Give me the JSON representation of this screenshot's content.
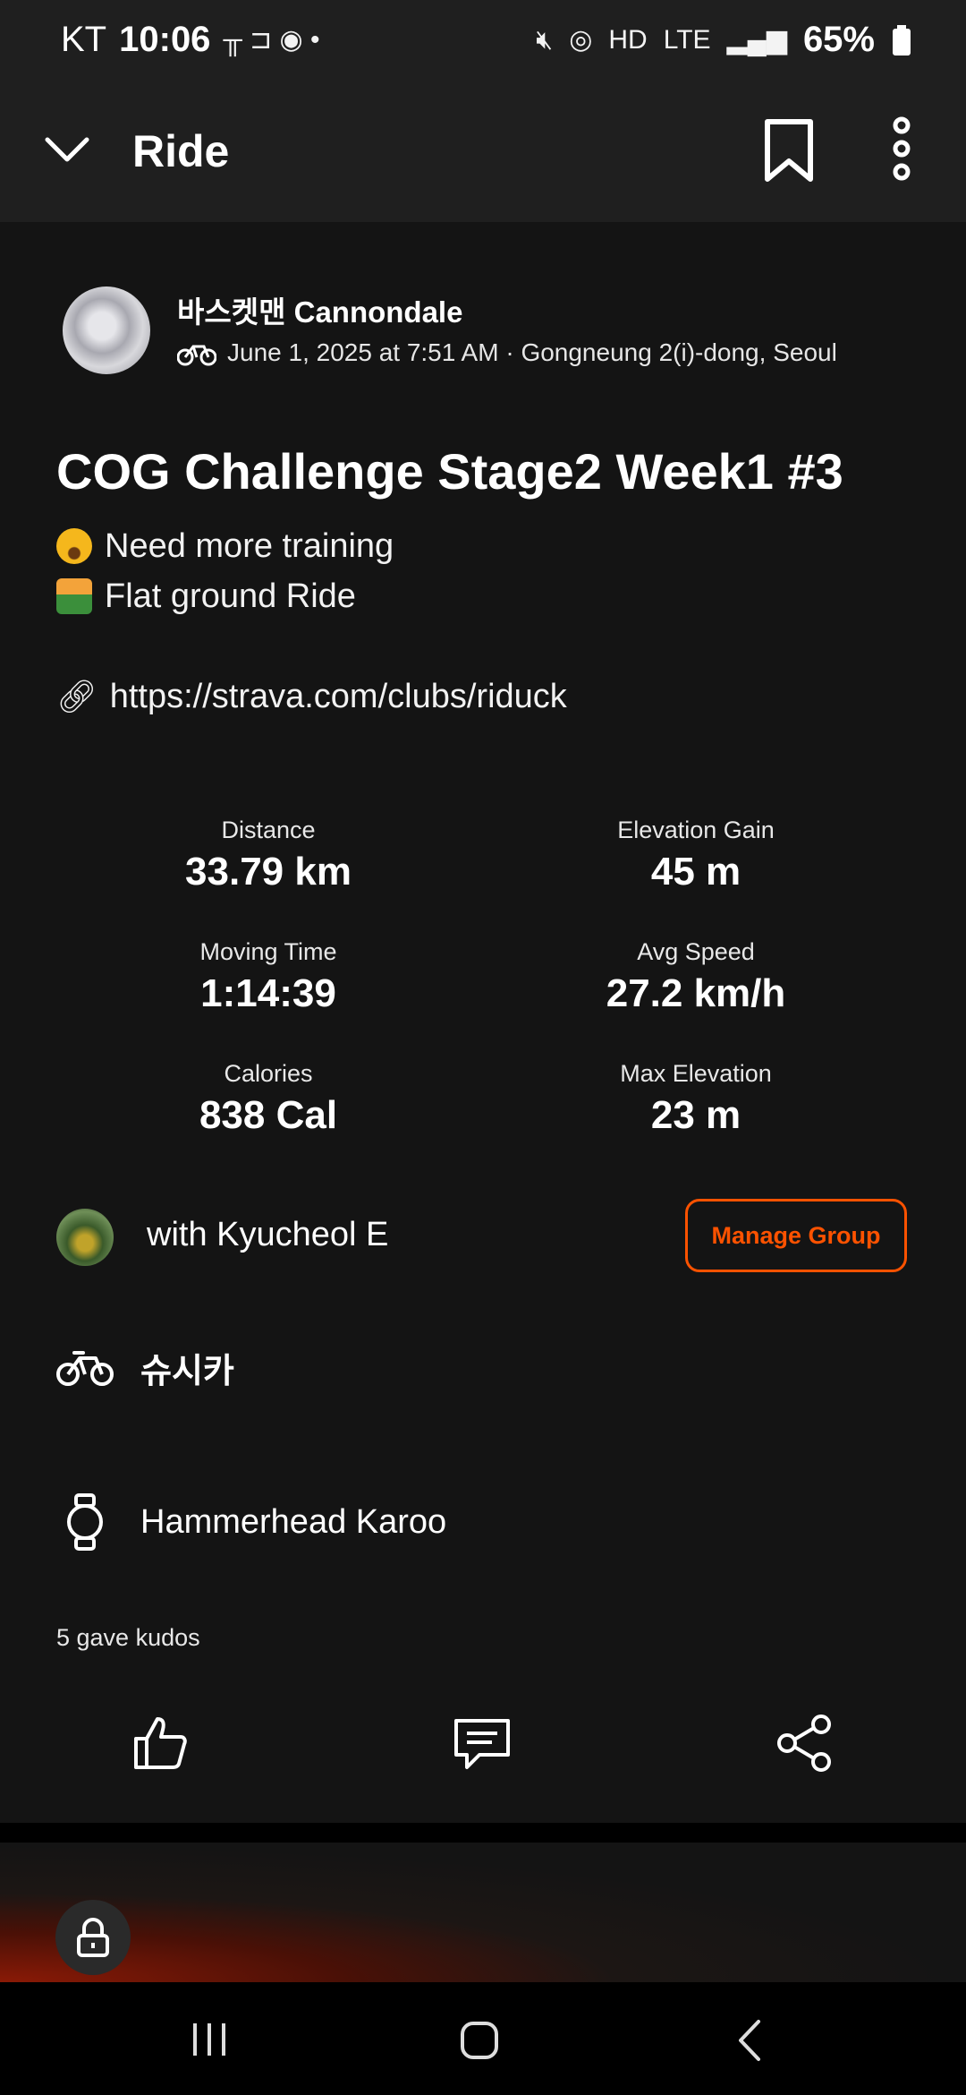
{
  "status_bar": {
    "carrier": "KT",
    "time": "10:06",
    "battery": "65%"
  },
  "header": {
    "title": "Ride"
  },
  "activity": {
    "author": "바스켓맨 Cannondale",
    "meta": "June 1, 2025 at 7:51 AM · Gongneung 2(i)-dong, Seoul",
    "title": "COG Challenge Stage2 Week1 #3",
    "description_line1": "Need more training",
    "description_line2": "Flat ground Ride",
    "link": "https://strava.com/clubs/riduck"
  },
  "stats": {
    "distance_label": "Distance",
    "distance_value": "33.79 km",
    "elevation_gain_label": "Elevation Gain",
    "elevation_gain_value": "45 m",
    "moving_time_label": "Moving Time",
    "moving_time_value": "1:14:39",
    "avg_speed_label": "Avg Speed",
    "avg_speed_value": "27.2 km/h",
    "calories_label": "Calories",
    "calories_value": "838 Cal",
    "max_elevation_label": "Max Elevation",
    "max_elevation_value": "23 m"
  },
  "group": {
    "with_text": "with Kyucheol E",
    "manage_label": "Manage Group"
  },
  "gear": {
    "bike_name": "슈시카",
    "device_name": "Hammerhead Karoo"
  },
  "kudos": {
    "text": "5 gave kudos"
  },
  "colors": {
    "accent": "#fc5200",
    "background": "#141414",
    "header_bg": "#1f1f1f"
  }
}
